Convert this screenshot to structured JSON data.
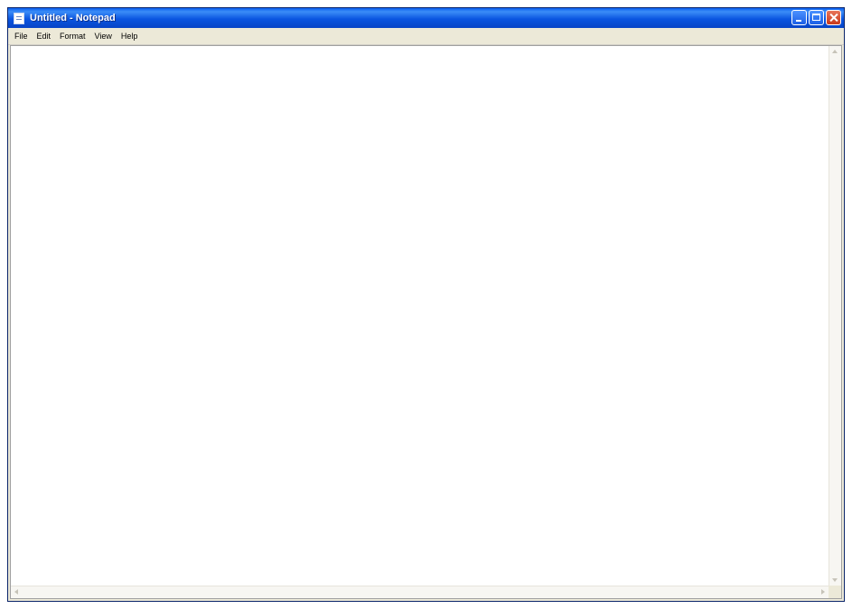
{
  "window": {
    "title": "Untitled - Notepad",
    "app_icon": "notepad-icon",
    "controls": [
      "minimize-icon",
      "maximize-icon",
      "close-icon"
    ]
  },
  "menu": {
    "file": "File",
    "edit": "Edit",
    "format": "Format",
    "view": "View",
    "help": "Help"
  },
  "editor": {
    "content": ""
  },
  "colors": {
    "titlebar": "#0a55e0",
    "close_button": "#c8391c",
    "menubar": "#ece9d8"
  }
}
